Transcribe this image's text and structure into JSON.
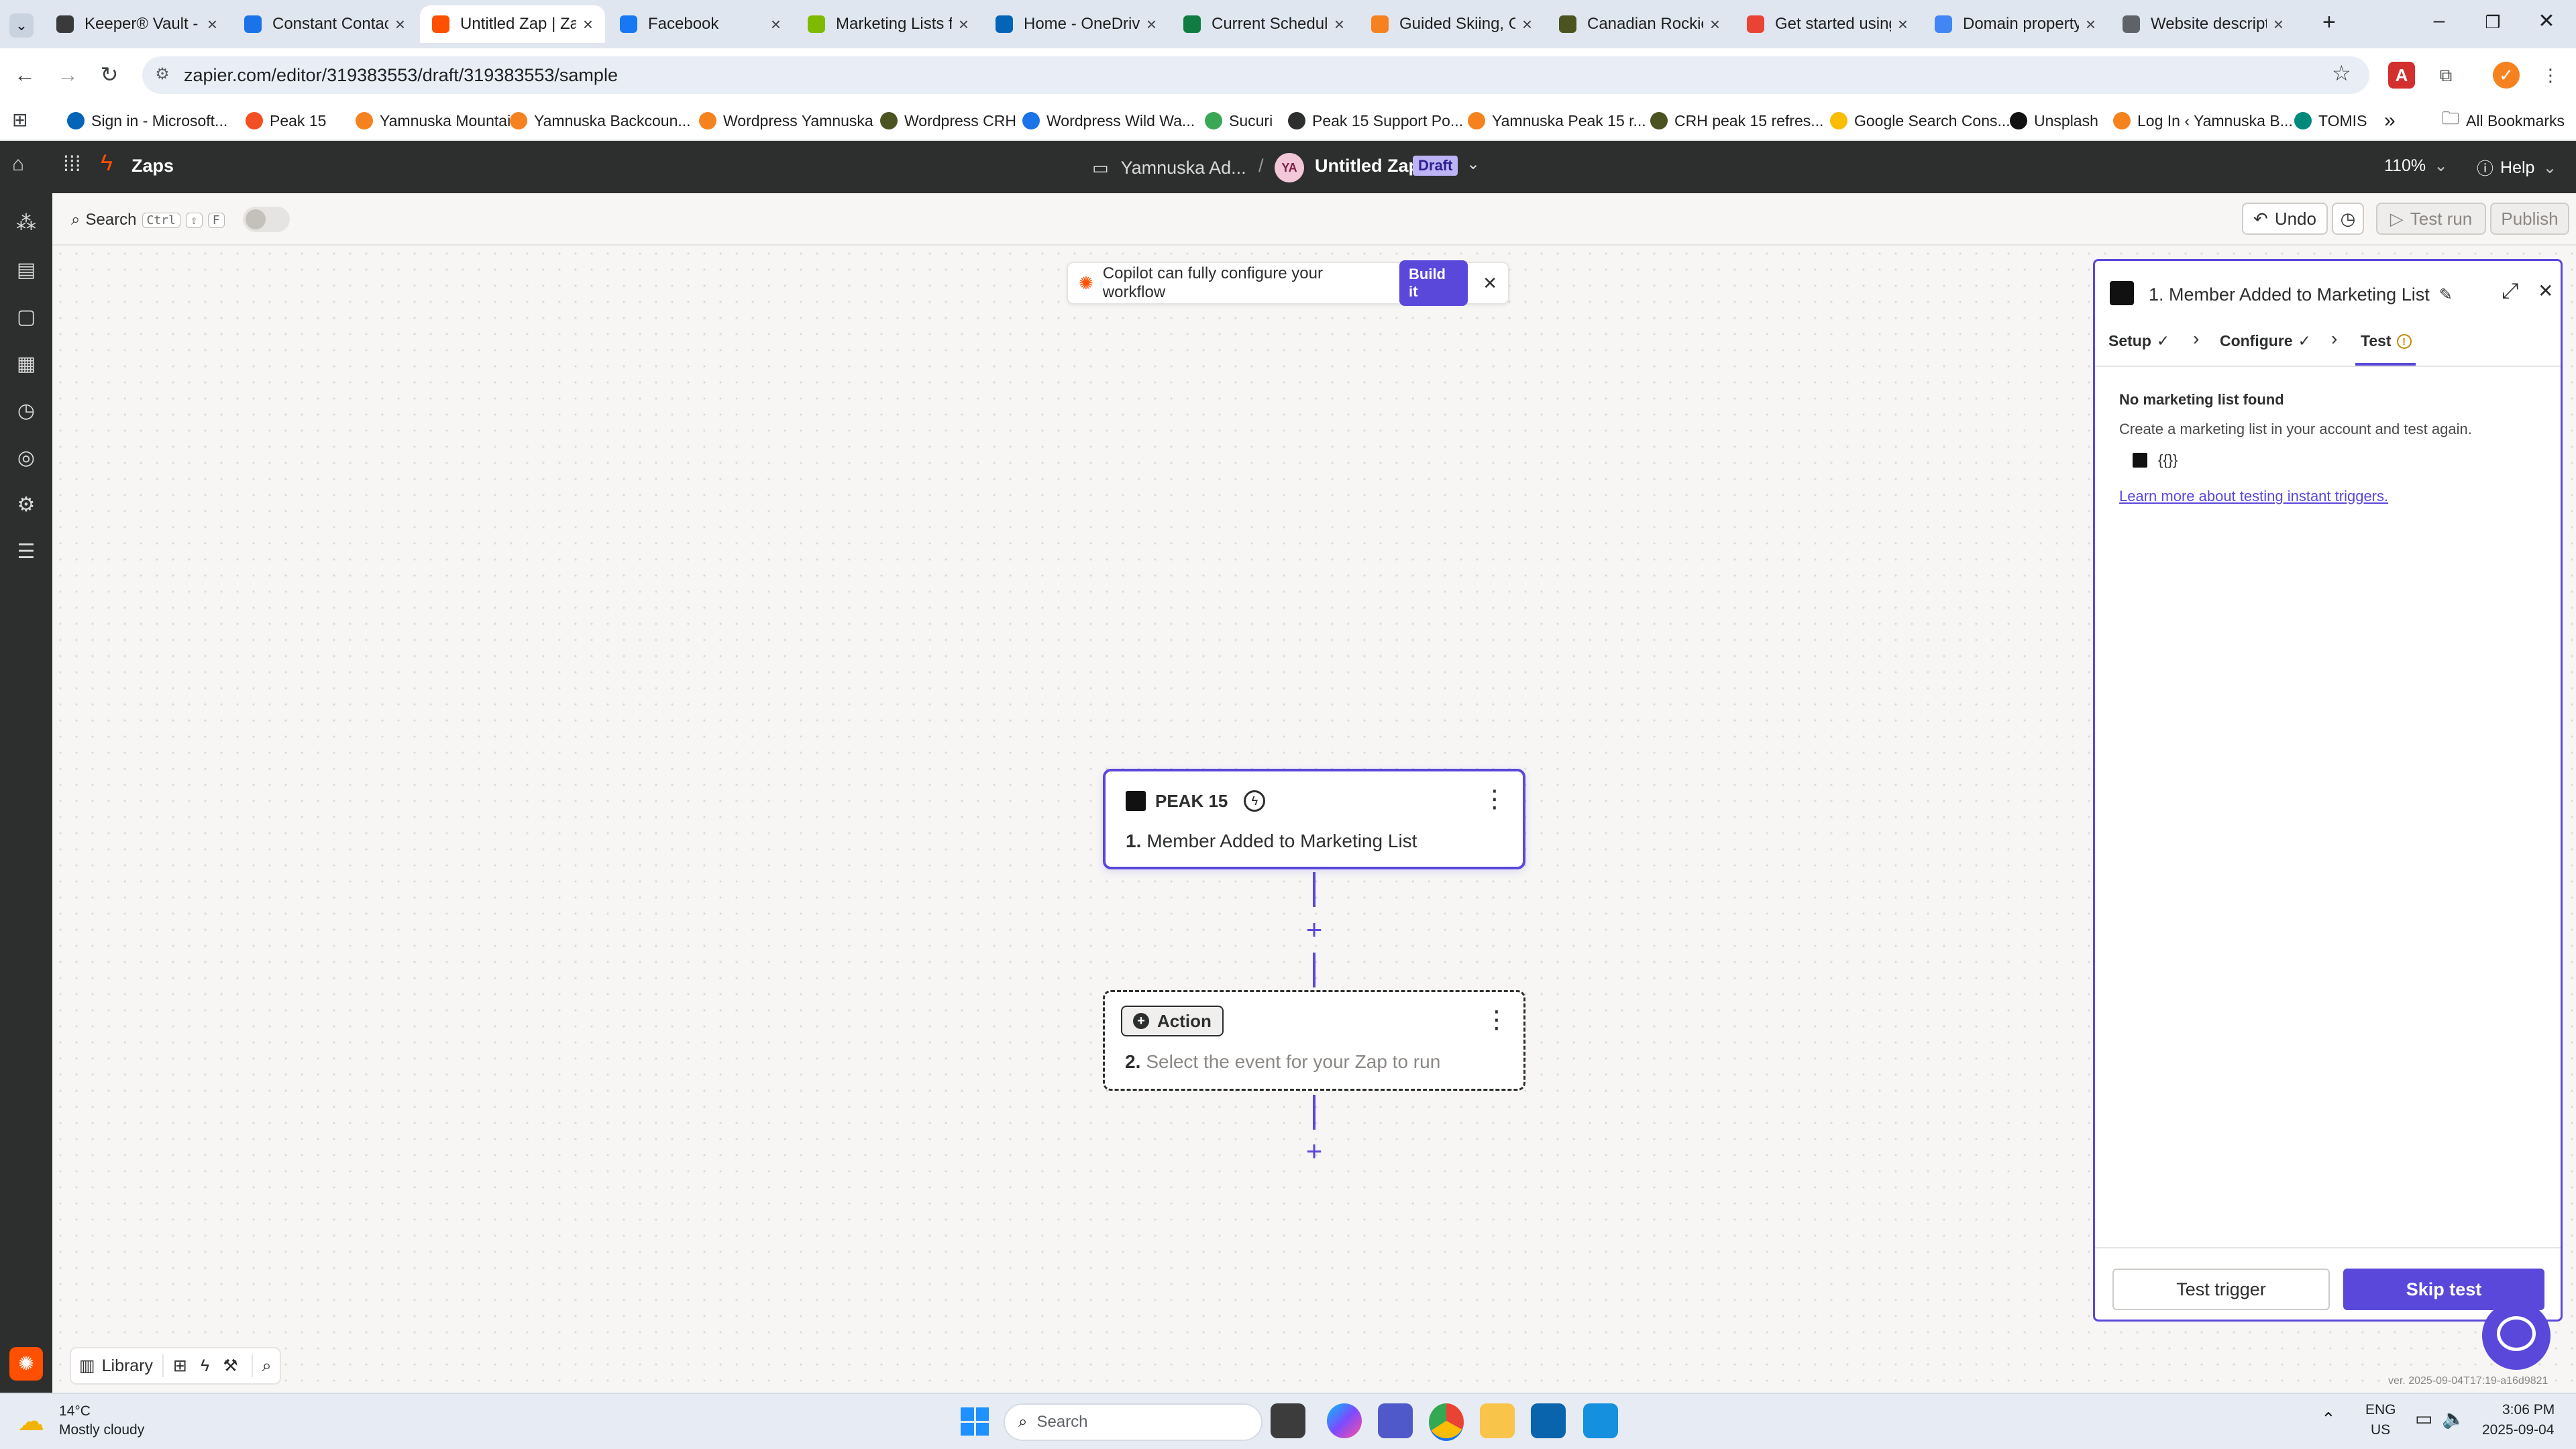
{
  "browser": {
    "tabs": [
      {
        "label": "Keeper® Vault -",
        "color": "#3a3a3a"
      },
      {
        "label": "Constant Contact",
        "color": "#1a73e8"
      },
      {
        "label": "Untitled Zap | Za",
        "color": "#ff4f00"
      },
      {
        "label": "Facebook",
        "color": "#1877f2"
      },
      {
        "label": "Marketing Lists f",
        "color": "#7fba00"
      },
      {
        "label": "Home - OneDrive",
        "color": "#0364b8"
      },
      {
        "label": "Current Schedule",
        "color": "#107c41"
      },
      {
        "label": "Guided Skiing, C",
        "color": "#f5821f"
      },
      {
        "label": "Canadian Rockie",
        "color": "#4b5320"
      },
      {
        "label": "Get started using",
        "color": "#ea4335"
      },
      {
        "label": "Domain property",
        "color": "#4285f4"
      },
      {
        "label": "Website descript",
        "color": "#5f6368"
      }
    ],
    "url": "zapier.com/editor/319383553/draft/319383553/sample",
    "bookmarks": [
      {
        "label": "Sign in - Microsoft...",
        "color": "#0364b8"
      },
      {
        "label": "Peak 15",
        "color": "#f25022"
      },
      {
        "label": "Yamnuska Mountai...",
        "color": "#f5821f"
      },
      {
        "label": "Yamnuska Backcoun...",
        "color": "#f5821f"
      },
      {
        "label": "Wordpress Yamnuska",
        "color": "#f5821f"
      },
      {
        "label": "Wordpress CRH",
        "color": "#4b5320"
      },
      {
        "label": "Wordpress Wild Wa...",
        "color": "#1a73e8"
      },
      {
        "label": "Sucuri",
        "color": "#3aa757"
      },
      {
        "label": "Peak 15 Support Po...",
        "color": "#2d2e2e"
      },
      {
        "label": "Yamnuska Peak 15 r...",
        "color": "#f5821f"
      },
      {
        "label": "CRH peak 15 refres...",
        "color": "#4b5320"
      },
      {
        "label": "Google Search Cons...",
        "color": "#fbbc04"
      },
      {
        "label": "Unsplash",
        "color": "#111111"
      },
      {
        "label": "Log In ‹ Yamnuska B...",
        "color": "#f5821f"
      },
      {
        "label": "TOMIS",
        "color": "#00897b"
      }
    ],
    "all_bookmarks": "All Bookmarks",
    "more_glyph": "»"
  },
  "zapier": {
    "app_name": "Zaps",
    "folder": "Yamnuska Ad...",
    "separator": "/",
    "avatar_initials": "YA",
    "zap_title": "Untitled Zap",
    "status_badge": "Draft",
    "zoom": "110%",
    "help": "Help",
    "search_label": "Search",
    "search_shortcut": [
      "Ctrl",
      "⇧",
      "F"
    ],
    "undo": "Undo",
    "test_run": "Test run",
    "publish": "Publish",
    "copilot_text": "Copilot can fully configure your workflow",
    "copilot_button": "Build it",
    "step1": {
      "app": "PEAK 15",
      "number": "1.",
      "title": "Member Added to Marketing List"
    },
    "step2": {
      "badge": "Action",
      "number": "2.",
      "title": "Select the event for your Zap to run"
    },
    "panel": {
      "title": "1. Member Added to Marketing List",
      "tabs": [
        "Setup",
        "Configure",
        "Test"
      ],
      "heading": "No marketing list found",
      "body": "Create a marketing list in your account and test again.",
      "payload": "{{}}",
      "link": "Learn more about testing instant triggers.",
      "test_trigger": "Test trigger",
      "skip_test": "Skip test"
    },
    "library": "Library",
    "version": "ver. 2025-09-04T17:19-a16d9821",
    "accent": "#5a48db",
    "brand_orange": "#ff4f00"
  },
  "taskbar": {
    "temperature": "14°C",
    "weather": "Mostly cloudy",
    "search": "Search",
    "lang_top": "ENG",
    "lang_bottom": "US",
    "time": "3:06 PM",
    "date": "2025-09-04"
  }
}
